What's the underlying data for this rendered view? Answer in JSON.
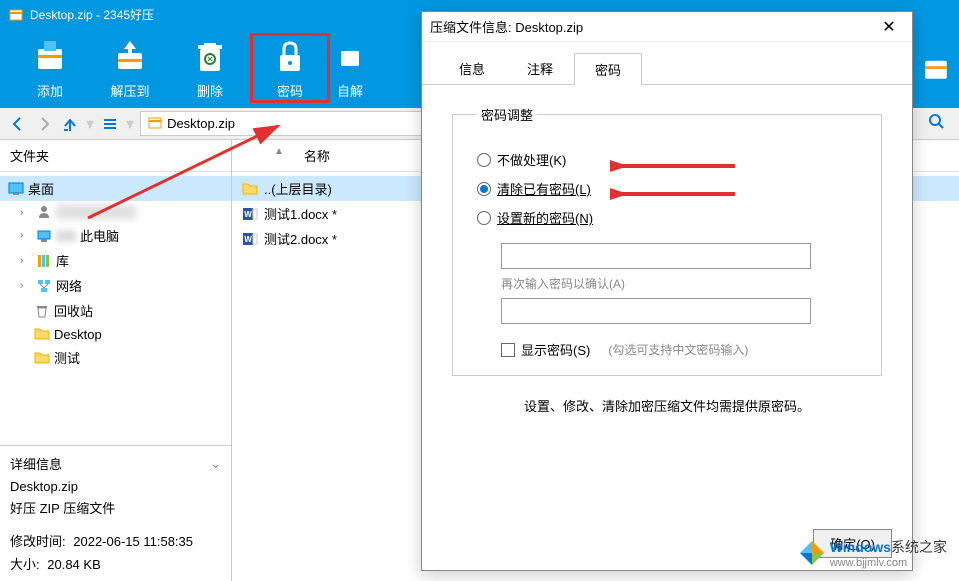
{
  "window": {
    "title": "Desktop.zip - 2345好压"
  },
  "toolbar": {
    "add": "添加",
    "extract": "解压到",
    "delete": "删除",
    "password": "密码",
    "selfextract": "自解"
  },
  "nav": {
    "archive_name": "Desktop.zip"
  },
  "sidebar": {
    "header": "文件夹",
    "items": [
      {
        "label": "桌面",
        "icon": "desktop"
      },
      {
        "label": "",
        "icon": "user",
        "blurred": true
      },
      {
        "label": "此电脑",
        "icon": "computer",
        "blurred_prefix": true
      },
      {
        "label": "库",
        "icon": "library"
      },
      {
        "label": "网络",
        "icon": "network"
      },
      {
        "label": "回收站",
        "icon": "recycle"
      },
      {
        "label": "Desktop",
        "icon": "folder"
      },
      {
        "label": "测试",
        "icon": "folder",
        "partial": true
      }
    ]
  },
  "details": {
    "header": "详细信息",
    "filename": "Desktop.zip",
    "type": "好压 ZIP 压缩文件",
    "modified_label": "修改时间:",
    "modified_value": "2022-06-15 11:58:35",
    "size_label": "大小:",
    "size_value": "20.84 KB"
  },
  "content": {
    "col_name": "名称",
    "files": [
      {
        "name": "..(上层目录)",
        "icon": "folder-up"
      },
      {
        "name": "测试1.docx *",
        "icon": "word"
      },
      {
        "name": "测试2.docx *",
        "icon": "word"
      }
    ]
  },
  "dialog": {
    "title": "压缩文件信息: Desktop.zip",
    "tabs": [
      "信息",
      "注释",
      "密码"
    ],
    "active_tab": 2,
    "fieldset_legend": "密码调整",
    "radio_none": "不做处理(K)",
    "radio_clear": "清除已有密码(L)",
    "radio_new": "设置新的密码(N)",
    "confirm_label": "再次输入密码以确认(A)",
    "show_password": "显示密码(S)",
    "cn_note": "(勾选可支持中文密码输入)",
    "note": "设置、修改、清除加密压缩文件均需提供原密码。",
    "ok": "确定(O)"
  },
  "watermark": {
    "brand": "Windows",
    "sub": "系统之家",
    "url": "www.bjjmlv.com"
  }
}
